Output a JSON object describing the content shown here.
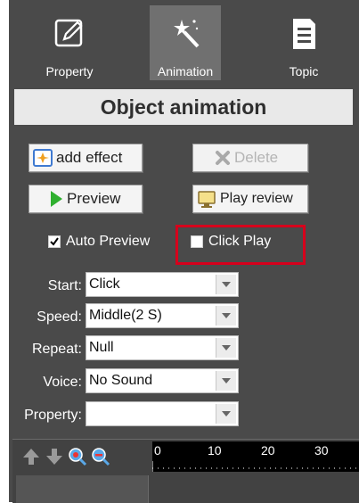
{
  "tabs": [
    {
      "label": "Property",
      "icon": "edit-icon"
    },
    {
      "label": "Animation",
      "icon": "magic-wand-icon"
    },
    {
      "label": "Topic",
      "icon": "document-icon"
    }
  ],
  "header": {
    "title": "Object animation"
  },
  "buttons": {
    "add_effect": "add effect",
    "delete": "Delete",
    "preview": "Preview",
    "play_review": "Play review"
  },
  "options": {
    "auto_preview": {
      "label": "Auto Preview",
      "checked": true
    },
    "click_play": {
      "label": "Click Play",
      "checked": false
    }
  },
  "fields": [
    {
      "label": "Start:",
      "value": "Click"
    },
    {
      "label": "Speed:",
      "value": "Middle(2 S)"
    },
    {
      "label": "Repeat:",
      "value": "Null"
    },
    {
      "label": "Voice:",
      "value": "No Sound"
    },
    {
      "label": "Property:",
      "value": ""
    }
  ],
  "timeline": {
    "ticks": [
      "0",
      "10",
      "20",
      "30"
    ],
    "toolbar_icons": [
      "arrow-up-icon",
      "arrow-down-icon",
      "zoom-in-icon",
      "zoom-out-icon"
    ]
  },
  "colors": {
    "highlight": "#d6001c",
    "panel": "#4a4a4a",
    "active_tab": "#707070"
  }
}
